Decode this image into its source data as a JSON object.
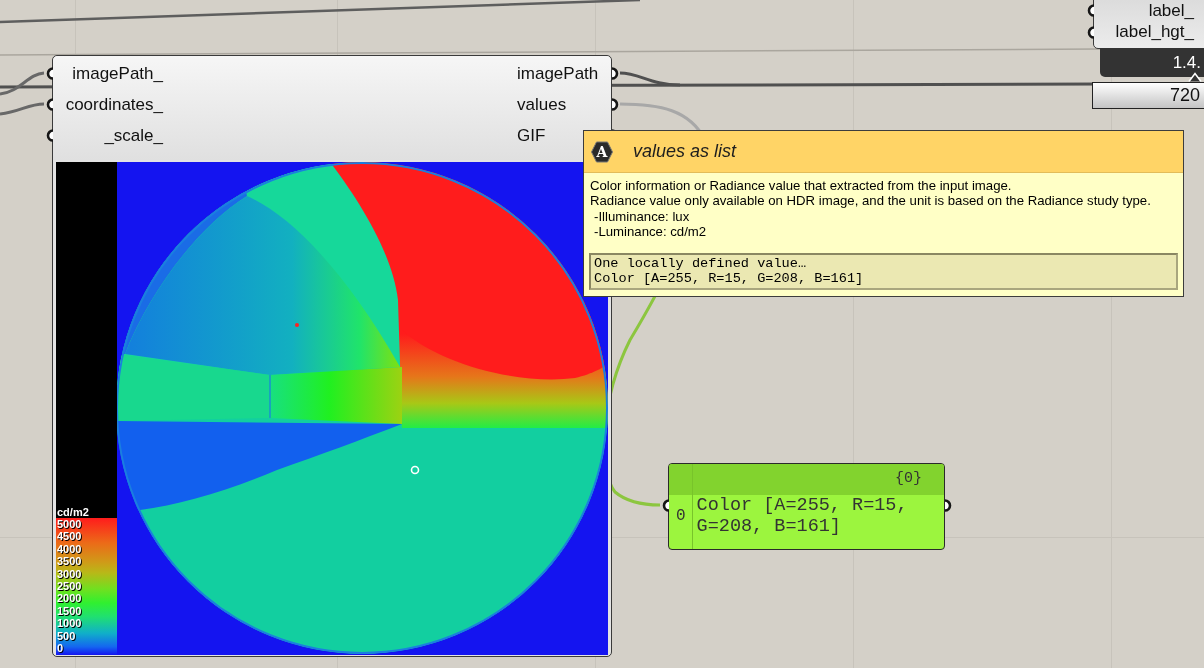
{
  "canvas": {
    "partial_node": {
      "inputs": [
        {
          "label": "label_"
        },
        {
          "label": "label_hgt_"
        }
      ],
      "readout": "1.4.",
      "slider_value": "720"
    },
    "component": {
      "inputs": [
        {
          "label": "imagePath_"
        },
        {
          "label": "coordinates_"
        },
        {
          "label": "_scale_"
        }
      ],
      "outputs": [
        {
          "label": "imagePath"
        },
        {
          "label": "values"
        },
        {
          "label": "GIF"
        }
      ],
      "legend": {
        "unit": "cd/m2",
        "labels": [
          "5000",
          "4500",
          "4000",
          "3500",
          "3000",
          "2500",
          "2000",
          "1500",
          "1000",
          "500",
          "0"
        ]
      }
    },
    "tooltip": {
      "icon_letter": "A",
      "title": "values as list",
      "description": [
        {
          "kind": "line",
          "text": "Color information or Radiance value that extracted from the input image."
        },
        {
          "kind": "line",
          "text": "Radiance value only available on HDR image, and the unit is based on the Radiance study type."
        },
        {
          "kind": "item",
          "text": "-Illuminance: lux"
        },
        {
          "kind": "item",
          "text": "-Luminance: cd/m2"
        }
      ],
      "value_preview": [
        "One locally defined value…",
        "Color [A=255, R=15, G=208, B=161]"
      ]
    },
    "panel": {
      "path": "{0}",
      "items": [
        {
          "index": "0",
          "value": "Color [A=255, R=15, G=208, B=161]"
        }
      ]
    }
  }
}
